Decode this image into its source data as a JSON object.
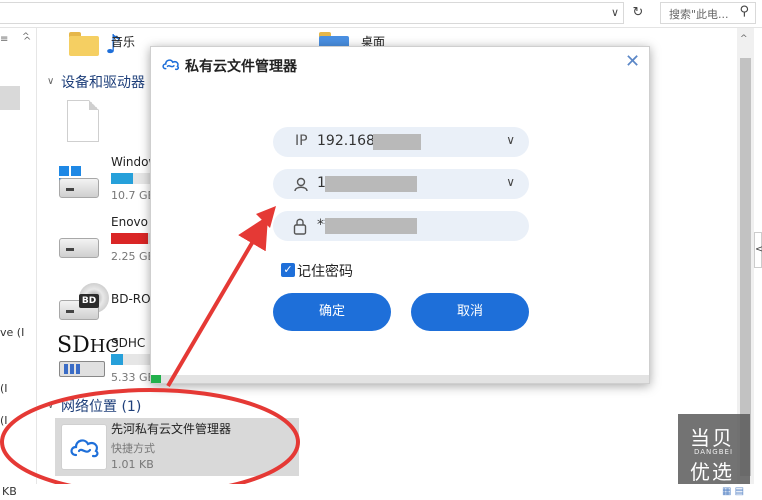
{
  "explorer": {
    "search_placeholder": "搜索\"此电...",
    "addr_dropdown_glyph": "∨",
    "refresh_glyph": "↻",
    "search_glyph": "⚲",
    "nav_pane": {
      "up_glyph": "^",
      "down_glyph": "v",
      "tick_glyph": "≡",
      "clipped_labels": [
        "ve (I",
        "(I",
        "(I"
      ]
    },
    "content": {
      "folders": [
        {
          "label": "音乐",
          "icon": "music-folder-icon"
        },
        {
          "label": "桌面",
          "icon": "desktop-folder-icon"
        }
      ],
      "section_devices": "设备和驱动器",
      "drives": [
        {
          "label": "Window",
          "sub": "10.7 GB",
          "fill_pct": 55,
          "bar_color": "#26a0da"
        },
        {
          "label": "Enovo",
          "sub": "2.25 GB",
          "fill_pct": 92,
          "bar_color": "#da2626"
        },
        {
          "label": "BD-RO",
          "sub": ""
        },
        {
          "label": "SDHC (",
          "sub": "5.33 GB",
          "fill_pct": 30,
          "bar_color": "#26a0da"
        }
      ],
      "bd_badge": "BD",
      "sdhc_badge": {
        "sd": "SD",
        "hc": "HC"
      },
      "section_network": "网络位置 (1)",
      "network_item": {
        "name": "先河私有云文件管理器",
        "type": "快捷方式",
        "size": "1.01 KB"
      }
    },
    "status_size": "KB",
    "view_icons": "▦ ▤",
    "side_chevron": "<"
  },
  "dialog": {
    "title": "私有云文件管理器",
    "close_glyph": "✕",
    "ip_prefix": "IP",
    "ip_value": "192.168.",
    "user_value": "1",
    "password_value": "**",
    "dropdown_glyph": "∨",
    "remember_label": "记住密码",
    "remember_checked": true,
    "checkmark": "✓",
    "confirm_label": "确定",
    "cancel_label": "取消",
    "progress_fraction": 0.02
  },
  "watermark": {
    "line1": "当贝",
    "line2": "DANGBEI",
    "line3": "优选"
  },
  "colors": {
    "accent": "#1e6fd9",
    "annotation_red": "#e53935",
    "progress_green": "#22b14c"
  }
}
